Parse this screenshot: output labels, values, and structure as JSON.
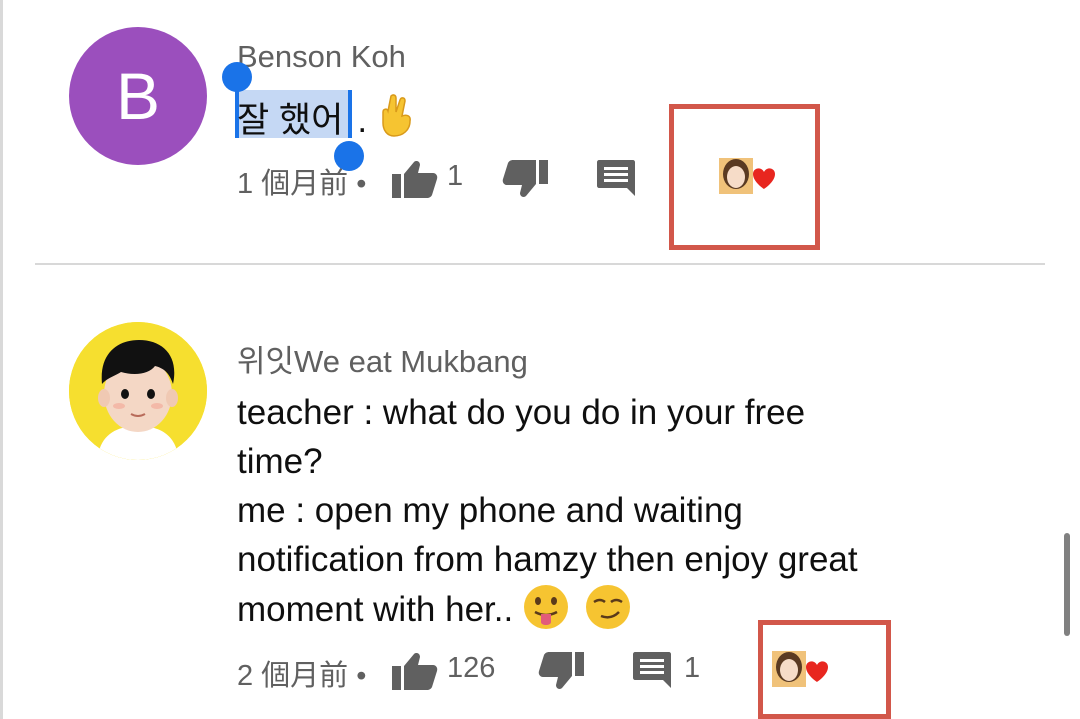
{
  "comments": [
    {
      "avatar_letter": "B",
      "author": "Benson Koh",
      "text_selected": "잘 했어",
      "text_rest": ".",
      "time": "1 個月前",
      "bullet": "•",
      "likes": "1",
      "replies": ""
    },
    {
      "author": "위잇We eat Mukbang",
      "text_lines": [
        "teacher : what do you do in your free",
        "time?",
        "me : open my phone and waiting",
        "notification from hamzy then enjoy great",
        "moment with her.."
      ],
      "time": "2 個月前",
      "bullet": "•",
      "likes": "126",
      "replies": "1"
    }
  ],
  "icons": {
    "like": "thumbs-up-icon",
    "dislike": "thumbs-down-icon",
    "reply": "reply-comment-icon",
    "creator_heart": "creator-heart-icon"
  },
  "colors": {
    "avatar_b": "#9b4fbd",
    "avatar_w_bg": "#f6df2f",
    "selection": "#c5d8f4",
    "selection_handle": "#1a73e8",
    "highlight_box": "#d2574a",
    "heart": "#e8261f",
    "meta_text": "#606060"
  }
}
